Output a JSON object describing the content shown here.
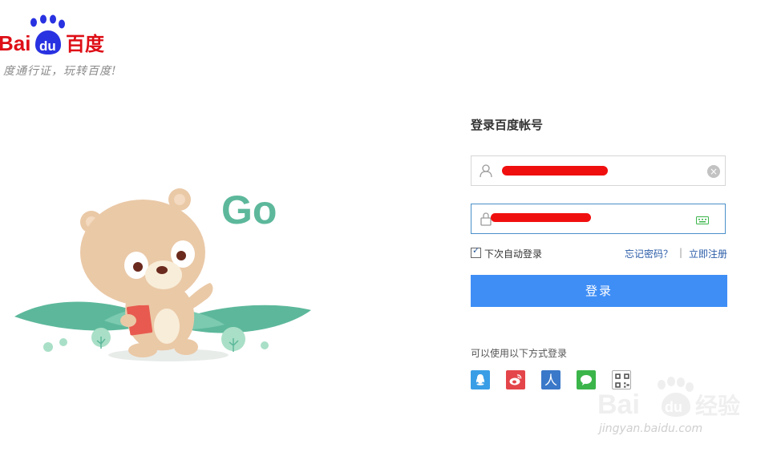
{
  "brand": {
    "logo_text_left": "Bai",
    "logo_text_du": "du",
    "logo_text_cn": "百度",
    "slogan": "度通行证，玩转百度!",
    "colors": {
      "red": "#de0e16",
      "blue": "#2932e1"
    }
  },
  "illustration": {
    "go_text": "Go"
  },
  "login": {
    "title": "登录百度帐号",
    "username_value": "",
    "password_value": "",
    "remember_label": "下次自动登录",
    "remember_checked": true,
    "forgot_label": "忘记密码？",
    "separator": "|",
    "register_label": "立即注册",
    "submit_label": "登录",
    "accent_color": "#3f8ef6"
  },
  "other_login": {
    "label": "可以使用以下方式登录",
    "providers": [
      {
        "name": "qq",
        "icon": "qq-icon",
        "color": "#3a9ee6"
      },
      {
        "name": "weibo",
        "icon": "weibo-icon",
        "color": "#e4454a"
      },
      {
        "name": "renren",
        "icon": "renren-icon",
        "color": "#3a78c9",
        "glyph": "人"
      },
      {
        "name": "wechat",
        "icon": "wechat-icon",
        "color": "#3bb54a"
      },
      {
        "name": "qrcode",
        "icon": "qrcode-icon",
        "color": "#777777"
      }
    ]
  },
  "watermark": {
    "text_left": "Bai",
    "text_du": "du",
    "text_cn": "经验",
    "url": "jingyan.baidu.com"
  }
}
